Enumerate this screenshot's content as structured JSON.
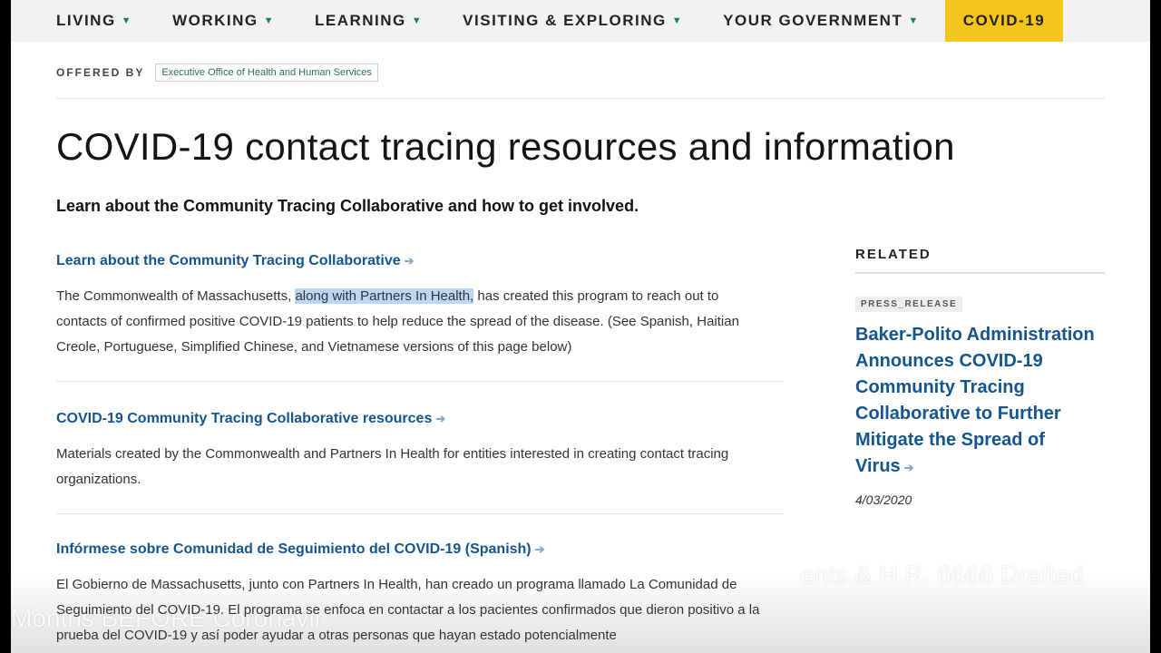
{
  "nav": {
    "items": [
      "LIVING",
      "WORKING",
      "LEARNING",
      "VISITING & EXPLORING",
      "YOUR GOVERNMENT"
    ],
    "covid": "COVID-19"
  },
  "offered": {
    "label": "OFFERED BY",
    "org": "Executive Office of Health and Human Services"
  },
  "title": "COVID-19 contact tracing resources and information",
  "lead": "Learn about the Community Tracing Collaborative and how to get involved.",
  "sections": [
    {
      "link": "Learn about the Community Tracing Collaborative",
      "text_pre": "The Commonwealth of Massachusetts, ",
      "text_hl": "along with Partners In Health,",
      "text_post": " has created this program to reach out to contacts of confirmed positive COVID-19 patients to help reduce the spread of the disease. (See Spanish, Haitian Creole, Portuguese, Simplified Chinese, and Vietnamese versions of this page below)"
    },
    {
      "link": "COVID-19 Community Tracing Collaborative resources",
      "text": "Materials created by the Commonwealth and Partners In Health for entities interested in creating contact tracing organizations."
    },
    {
      "link": "Infórmese sobre Comunidad de Seguimiento del COVID-19 (Spanish)",
      "text": "El Gobierno de Massachusetts, junto con Partners In Health, han creado un programa llamado La Comunidad de Seguimiento del COVID-19. El programa se enfoca en contactar a los pacientes confirmados que dieron positivo a la prueba del COVID-19 y así poder ayudar a otras personas que hayan estado potencialmente"
    }
  ],
  "related": {
    "label": "RELATED",
    "badge": "PRESS_RELEASE",
    "link": "Baker-Polito Administration Announces COVID-19 Community Tracing Collaborative to Further Mitigate the Spread of Virus",
    "date": "4/03/2020"
  },
  "caption": {
    "line1": "ents & H.R. 6666 Drafted",
    "line2": "Months BEFORE Coronavir"
  }
}
